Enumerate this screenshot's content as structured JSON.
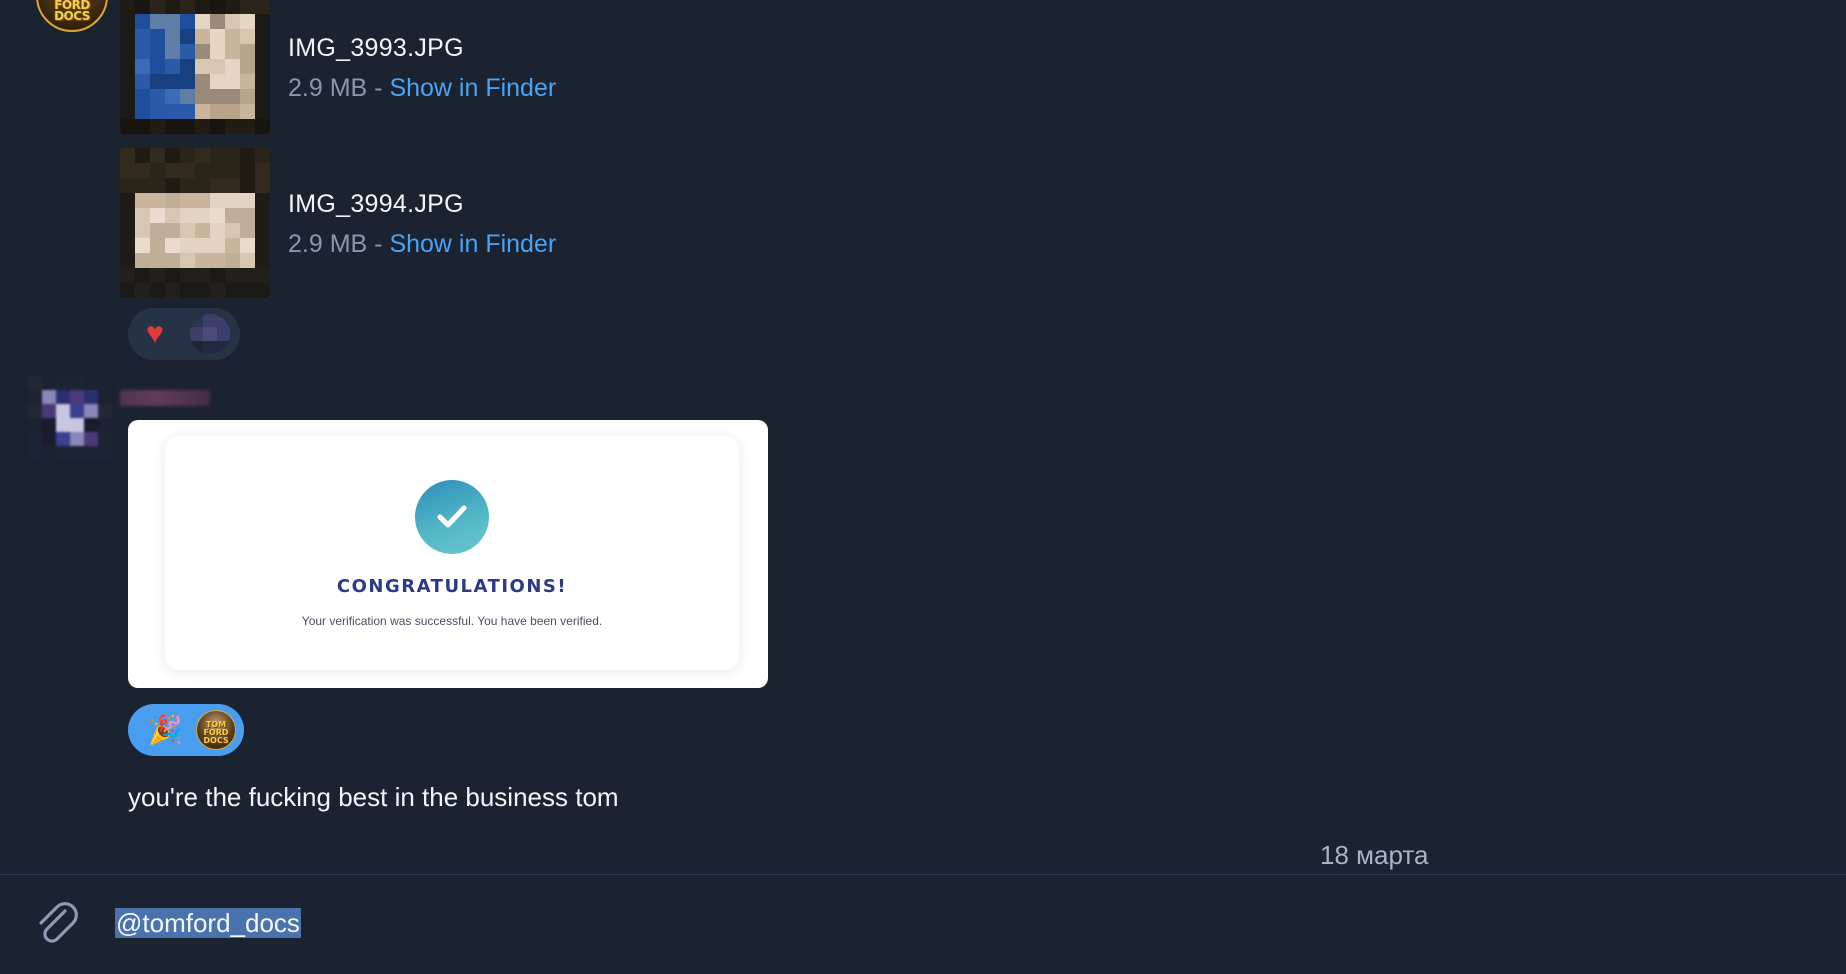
{
  "avatars": {
    "tomford_top_text": "TOM FORD DOCS",
    "tomford_reaction_text": "TOM FORD DOCS"
  },
  "files": [
    {
      "name": "IMG_3993.JPG",
      "size": "2.9 MB",
      "separator": "-",
      "action": "Show in Finder"
    },
    {
      "name": "IMG_3994.JPG",
      "size": "2.9 MB",
      "separator": "-",
      "action": "Show in Finder"
    }
  ],
  "reactions": {
    "first": {
      "emoji": "♥",
      "icon": "heart-icon"
    },
    "second": {
      "emoji": "🎉",
      "icon": "party-popper-icon"
    }
  },
  "photo_card": {
    "heading": "CONGRATULATIONS!",
    "body": "Your verification was successful. You have been verified."
  },
  "message": {
    "text": "you're the fucking best in the business tom"
  },
  "date_separator": "18 марта",
  "composer": {
    "input_value": "@tomford_docs",
    "attach_icon": "paperclip-icon"
  },
  "colors": {
    "background": "#1b2230",
    "link": "#4aa3f5",
    "reaction_active": "#4a9ef0",
    "reaction_inactive": "#263346",
    "selection": "#4a72ad"
  }
}
